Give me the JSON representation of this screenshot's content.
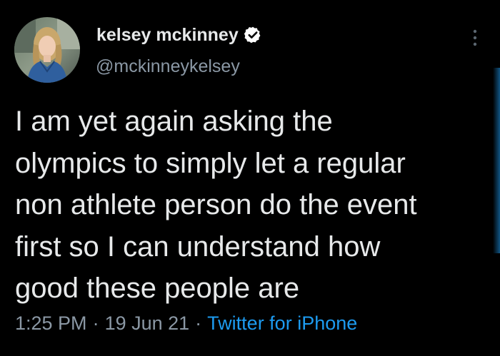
{
  "tweet": {
    "author": {
      "display_name": "kelsey mckinney",
      "handle": "@mckinneykelsey",
      "verified": true,
      "avatar_icon": "profile-photo"
    },
    "text_lines": [
      "I am yet again asking the",
      "olympics to simply let a regular",
      "non athlete person do the event",
      "first so I can understand how",
      "good these people are"
    ],
    "time": "1:25 PM",
    "date": "19 Jun 21",
    "separator": "·",
    "source": "Twitter for iPhone",
    "more_icon": "more-options-icon"
  },
  "colors": {
    "background": "#000000",
    "primary_text": "#e7e9ea",
    "secondary_text": "#8b98a5",
    "link": "#1d9bf0"
  }
}
